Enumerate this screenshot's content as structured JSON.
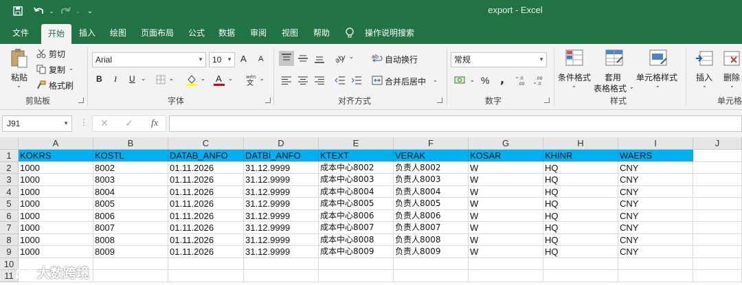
{
  "window": {
    "title": "export  -  Excel"
  },
  "ribbon_tabs": [
    "文件",
    "开始",
    "插入",
    "绘图",
    "页面布局",
    "公式",
    "数据",
    "审阅",
    "视图",
    "帮助",
    "操作说明搜索"
  ],
  "clipboard": {
    "paste": "粘贴",
    "cut": "剪切",
    "copy": "复制",
    "format_painter": "格式刷",
    "label": "剪贴板"
  },
  "font": {
    "name": "Arial",
    "size": "10",
    "bold": "B",
    "italic": "I",
    "underline": "U",
    "grow": "A",
    "shrink": "A",
    "label": "字体"
  },
  "alignment": {
    "wrap": "自动换行",
    "merge": "合并后居中",
    "label": "对齐方式"
  },
  "number": {
    "format": "常规",
    "percent": "%",
    "comma": ",",
    "label": "数字"
  },
  "styles": {
    "conditional": "条件格式",
    "table_1": "套用",
    "table_2": "表格格式",
    "cell_styles": "单元格样式",
    "label": "样式"
  },
  "cells": {
    "insert": "插入",
    "delete": "删除",
    "label": "单元格"
  },
  "formula_bar": {
    "name_box": "J91",
    "fx": "fx",
    "formula": ""
  },
  "sheet": {
    "columns": [
      "A",
      "B",
      "C",
      "D",
      "E",
      "F",
      "G",
      "H",
      "I",
      "J"
    ],
    "row_numbers": [
      "1",
      "2",
      "3",
      "4",
      "5",
      "6",
      "7",
      "8",
      "9",
      "10",
      "11"
    ],
    "header": [
      "KOKRS",
      "KOSTL",
      "DATAB_ANFO",
      "DATBI_ANFO",
      "KTEXT",
      "VERAK",
      "KOSAR",
      "KHINR",
      "WAERS"
    ],
    "rows": [
      [
        "1000",
        "8002",
        "01.11.2026",
        "31.12.9999",
        "成本中心8002",
        "负责人8002",
        "W",
        "HQ",
        "CNY"
      ],
      [
        "1000",
        "8003",
        "01.11.2026",
        "31.12.9999",
        "成本中心8003",
        "负责人8003",
        "W",
        "HQ",
        "CNY"
      ],
      [
        "1000",
        "8004",
        "01.11.2026",
        "31.12.9999",
        "成本中心8004",
        "负责人8004",
        "W",
        "HQ",
        "CNY"
      ],
      [
        "1000",
        "8005",
        "01.11.2026",
        "31.12.9999",
        "成本中心8005",
        "负责人8005",
        "W",
        "HQ",
        "CNY"
      ],
      [
        "1000",
        "8006",
        "01.11.2026",
        "31.12.9999",
        "成本中心8006",
        "负责人8006",
        "W",
        "HQ",
        "CNY"
      ],
      [
        "1000",
        "8007",
        "01.11.2026",
        "31.12.9999",
        "成本中心8007",
        "负责人8007",
        "W",
        "HQ",
        "CNY"
      ],
      [
        "1000",
        "8008",
        "01.11.2026",
        "31.12.9999",
        "成本中心8008",
        "负责人8008",
        "W",
        "HQ",
        "CNY"
      ],
      [
        "1000",
        "8009",
        "01.11.2026",
        "31.12.9999",
        "成本中心8009",
        "负责人8009",
        "W",
        "HQ",
        "CNY"
      ]
    ]
  },
  "watermark": "大数跨境",
  "colors": {
    "excel_green": "#217346",
    "header_fill": "#00b0f0"
  }
}
